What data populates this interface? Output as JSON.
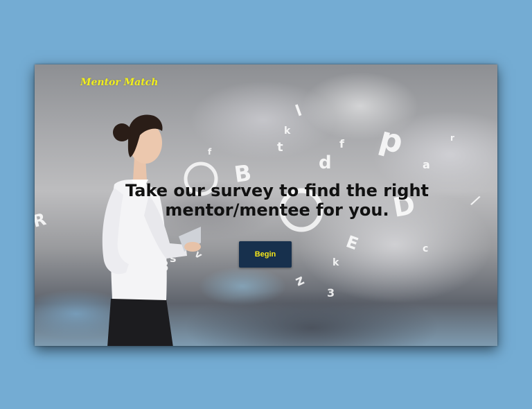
{
  "brand": {
    "name": "Mentor Match",
    "color": "#f2ef1c"
  },
  "hero": {
    "headline_line1": "Take our survey to find the right",
    "headline_line2": "mentor/mentee for you.",
    "background": "cloudy-sky-with-flying-letters-photo",
    "figure": "woman-holding-tablet-photo"
  },
  "cta": {
    "begin_label": "Begin",
    "background_color": "#17304d",
    "text_color": "#f5e51a"
  },
  "page": {
    "background_color": "#74acd3"
  }
}
